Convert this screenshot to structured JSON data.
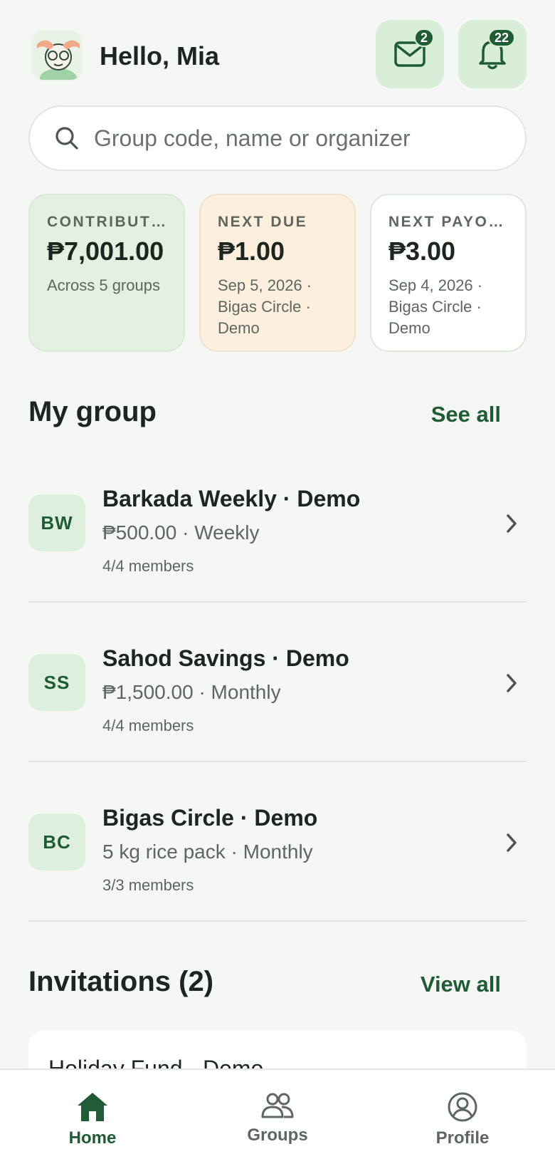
{
  "header": {
    "greeting": "Hello, Mia",
    "messages_badge": "2",
    "notifications_badge": "22"
  },
  "search": {
    "placeholder": "Group code, name or organizer"
  },
  "stats": [
    {
      "label": "CONTRIBUTIONS",
      "amount": "₱7,001.00",
      "sub": "Across 5 groups"
    },
    {
      "label": "NEXT DUE",
      "amount": "₱1.00",
      "sub": "Sep 5, 2026 · Bigas Circle · Demo"
    },
    {
      "label": "NEXT PAYOUT",
      "amount": "₱3.00",
      "sub": "Sep 4, 2026 · Bigas Circle · Demo"
    }
  ],
  "my_group": {
    "title": "My group",
    "see_all": "See all",
    "groups": [
      {
        "initials": "BW",
        "name": "Barkada Weekly · Demo",
        "info": "₱500.00 · Weekly",
        "members": "4/4 members"
      },
      {
        "initials": "SS",
        "name": "Sahod Savings · Demo",
        "info": "₱1,500.00 · Monthly",
        "members": "4/4 members"
      },
      {
        "initials": "BC",
        "name": "Bigas Circle · Demo",
        "info": "5 kg rice pack · Monthly",
        "members": "3/3 members"
      }
    ]
  },
  "invitations": {
    "title": "Invitations (2)",
    "view_all": "View all",
    "items": [
      {
        "name": "Holiday Fund · Demo"
      }
    ]
  },
  "nav": {
    "home": "Home",
    "groups": "Groups",
    "profile": "Profile"
  },
  "colors": {
    "accent": "#1f5c35",
    "background": "#f4f7f3",
    "card_green": "#e2f1e0",
    "card_peach": "#fdefdd"
  }
}
